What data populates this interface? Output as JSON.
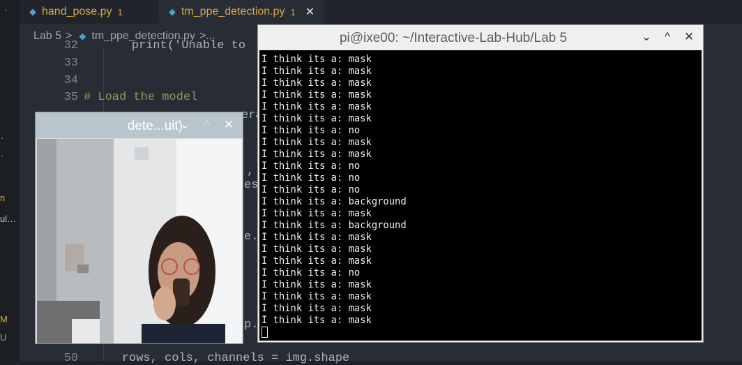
{
  "activity_bar": {
    "marks": [
      "·",
      "·",
      "·",
      "n",
      "ul…",
      "M",
      "U"
    ]
  },
  "tabs": [
    {
      "label": "hand_pose.py",
      "count": "1",
      "active": false
    },
    {
      "label": "tm_ppe_detection.py",
      "count": "1",
      "active": true
    }
  ],
  "breadcrumb": {
    "folder": "Lab 5",
    "sep": ">",
    "file": "tm_ppe_detection.py",
    "more": ">..."
  },
  "editor": {
    "lines": [
      {
        "num": "32",
        "text": "    print('Unable to"
      },
      {
        "num": "33",
        "text": ""
      },
      {
        "num": "34",
        "text": ""
      },
      {
        "num": "35",
        "text": "# Load the model"
      },
      {
        "num": "50",
        "text": "    rows, cols, channels = img.shape"
      }
    ],
    "fragments": [
      "era",
      ",",
      "es",
      "e.",
      "p."
    ]
  },
  "terminal": {
    "title": "pi@ixe00: ~/Interactive-Lab-Hub/Lab 5",
    "lines": [
      "I think its a: mask",
      "I think its a: mask",
      "I think its a: mask",
      "I think its a: mask",
      "I think its a: mask",
      "I think its a: mask",
      "I think its a: no",
      "I think its a: mask",
      "I think its a: mask",
      "I think its a: no",
      "I think its a: no",
      "I think its a: no",
      "I think its a: background",
      "I think its a: mask",
      "I think its a: background",
      "I think its a: mask",
      "I think its a: mask",
      "I think its a: mask",
      "I think its a: no",
      "I think its a: mask",
      "I think its a: mask",
      "I think its a: mask",
      "I think its a: mask"
    ]
  },
  "camera_window": {
    "title": "dete...uit)"
  },
  "window_buttons": {
    "minimize": "⌄",
    "maximize": "^",
    "close": "✕"
  },
  "colors": {
    "editor_bg": "#282c34",
    "tab_text": "#d7a845",
    "terminal_bg": "#000000",
    "comment": "#7f9f5f"
  }
}
